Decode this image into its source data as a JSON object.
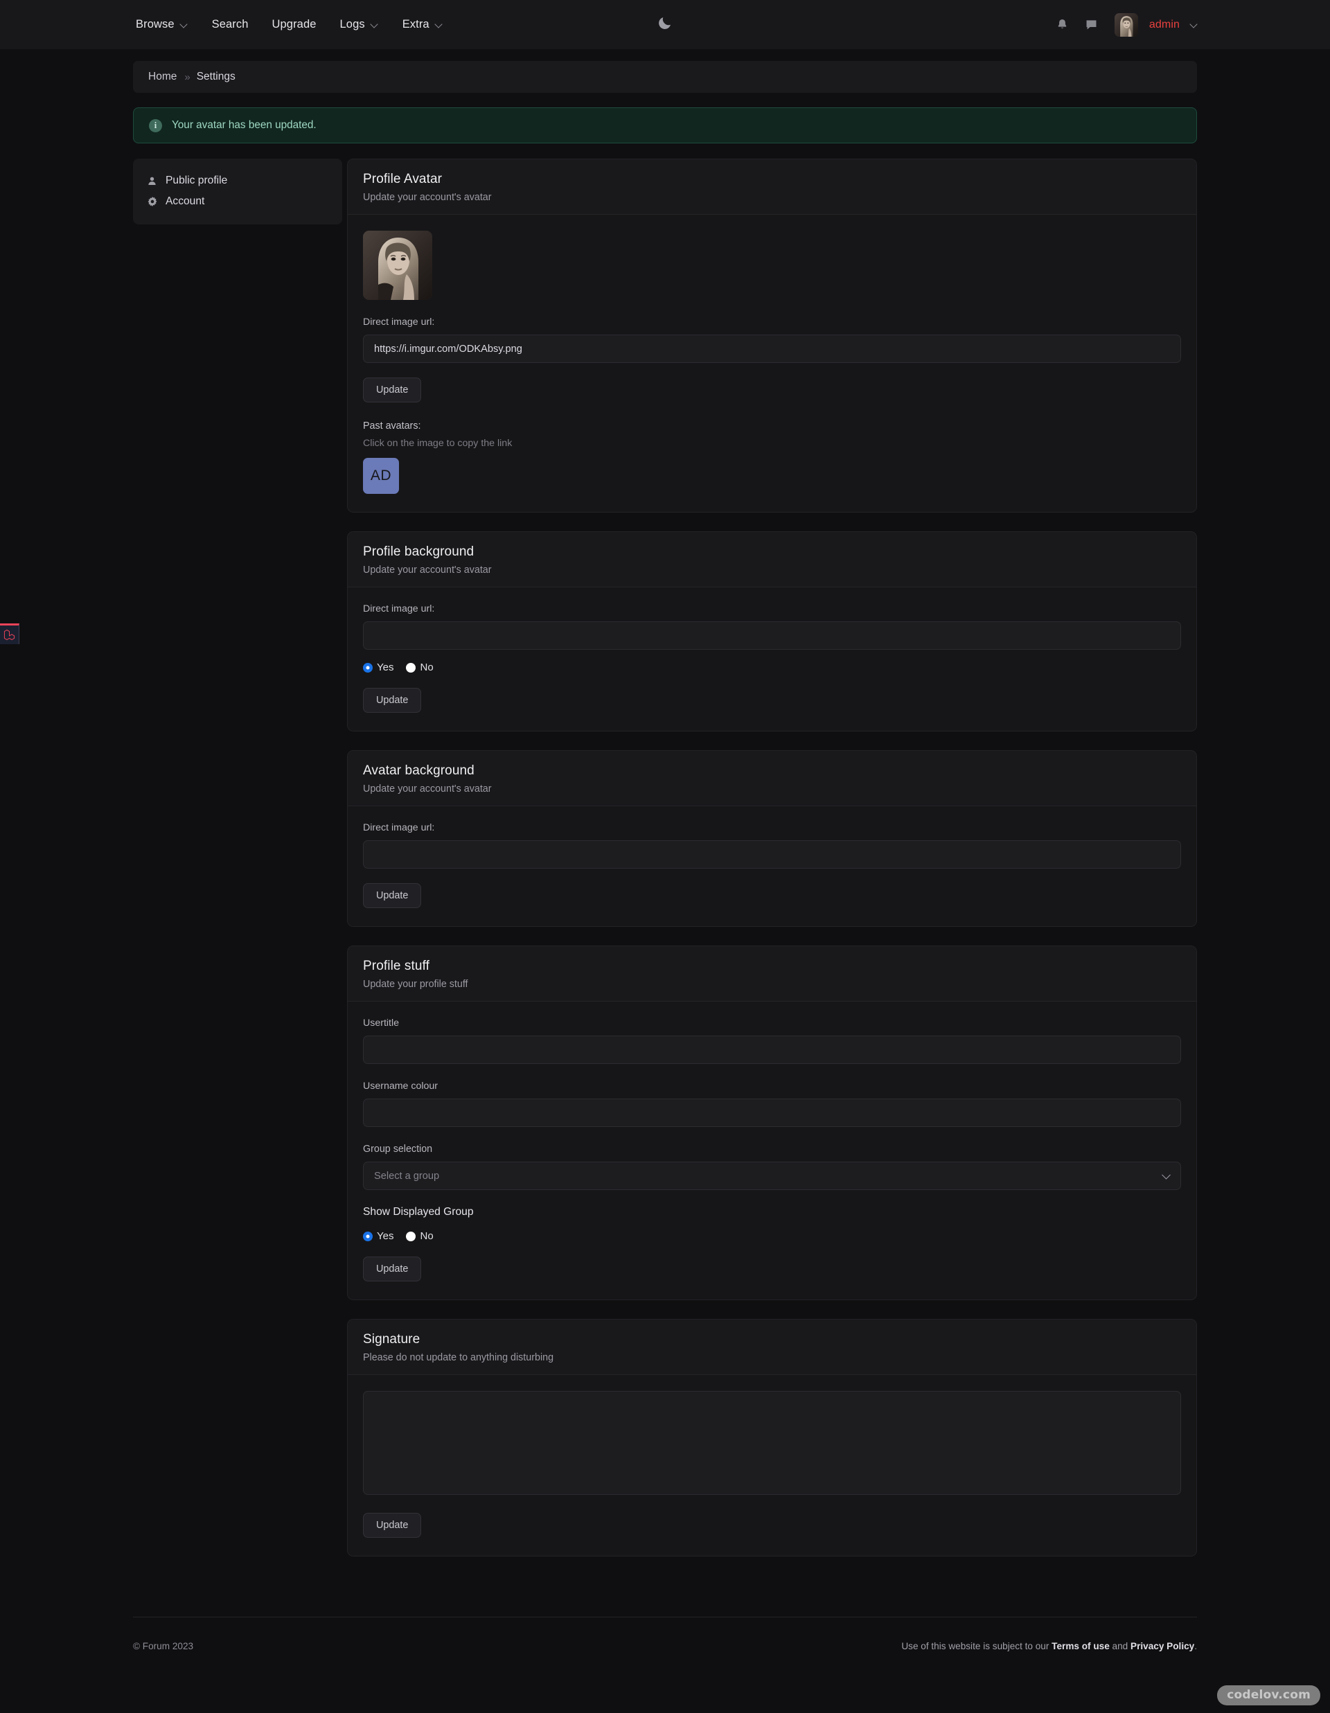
{
  "navbar": {
    "items": [
      {
        "label": "Browse",
        "has_caret": true
      },
      {
        "label": "Search",
        "has_caret": false
      },
      {
        "label": "Upgrade",
        "has_caret": false
      },
      {
        "label": "Logs",
        "has_caret": true
      },
      {
        "label": "Extra",
        "has_caret": true
      }
    ],
    "theme_toggle_icon": "moon-icon",
    "notifications_icon": "bell-icon",
    "messages_icon": "chat-bubble-icon",
    "avatar_icon": "user-avatar-photo",
    "username": "admin",
    "user_caret_icon": "chevron-down-icon"
  },
  "breadcrumb": {
    "home": "Home",
    "separator": "»",
    "current": "Settings"
  },
  "alert": {
    "icon": "info-icon",
    "icon_glyph": "i",
    "message": "Your avatar has been updated.",
    "border_color": "#1f4b3d",
    "background_color": "#10261f",
    "text_color": "#9fd8c2"
  },
  "sidebar": {
    "items": [
      {
        "label": "Public profile",
        "icon": "user-icon"
      },
      {
        "label": "Account",
        "icon": "gear-icon"
      }
    ]
  },
  "cards": {
    "profile_avatar": {
      "title": "Profile Avatar",
      "subtitle": "Update your account's avatar",
      "avatar_alt": "current-avatar-photo",
      "url_label": "Direct image url:",
      "url_value": "https://i.imgur.com/ODKAbsy.png",
      "url_placeholder": "",
      "update_label": "Update",
      "past_label": "Past avatars:",
      "past_hint": "Click on the image to copy the link",
      "past_items": [
        {
          "initials": "AD",
          "color": "#6b7ab8"
        }
      ]
    },
    "profile_background": {
      "title": "Profile background",
      "subtitle": "Update your account's avatar",
      "url_label": "Direct image url:",
      "url_value": "",
      "url_placeholder": "",
      "radio_yes": "Yes",
      "radio_no": "No",
      "radio_selected": "Yes",
      "update_label": "Update"
    },
    "avatar_background": {
      "title": "Avatar background",
      "subtitle": "Update your account's avatar",
      "url_label": "Direct image url:",
      "url_value": "",
      "url_placeholder": "",
      "update_label": "Update"
    },
    "profile_stuff": {
      "title": "Profile stuff",
      "subtitle": "Update your profile stuff",
      "usertitle_label": "Usertitle",
      "usertitle_value": "",
      "usertitle_placeholder": "",
      "username_colour_label": "Username colour",
      "username_colour_value": "",
      "username_colour_placeholder": "",
      "group_label": "Group selection",
      "group_selected": "Select a group",
      "show_group_label": "Show Displayed Group",
      "radio_yes": "Yes",
      "radio_no": "No",
      "radio_selected": "Yes",
      "update_label": "Update"
    },
    "signature": {
      "title": "Signature",
      "subtitle": "Please do not update to anything disturbing",
      "value": "",
      "placeholder": "",
      "update_label": "Update"
    }
  },
  "footer": {
    "copyright": "© Forum 2023",
    "legal_prefix": "Use of this website is subject to our ",
    "terms_label": "Terms of use",
    "legal_middle": " and ",
    "privacy_label": "Privacy Policy",
    "legal_suffix": "."
  },
  "debug_tab": {
    "icon": "laravel-logo-icon",
    "accent": "#ec4358"
  },
  "watermark": {
    "text": "codelov.com"
  }
}
